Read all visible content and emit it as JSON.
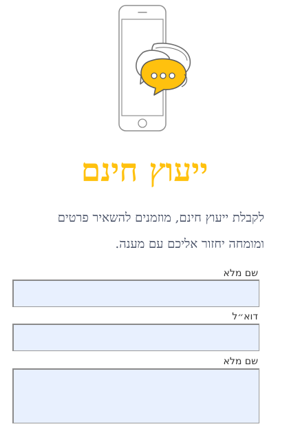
{
  "hero": {
    "illustration_icon": "phone-chat-bubbles-icon",
    "accent_color": "#ffc10e"
  },
  "title": "ייעוץ חינם",
  "description_lines": [
    "לקבלת ייעוץ חינם, מוזמנים להשאיר פרטים",
    "ומומחה יחזור אליכם עם מענה."
  ],
  "form": {
    "name_label": "שם מלא",
    "name_value": "",
    "email_label": "דוא״ל",
    "email_value": "",
    "message_label": "שם מלא",
    "message_value": ""
  }
}
